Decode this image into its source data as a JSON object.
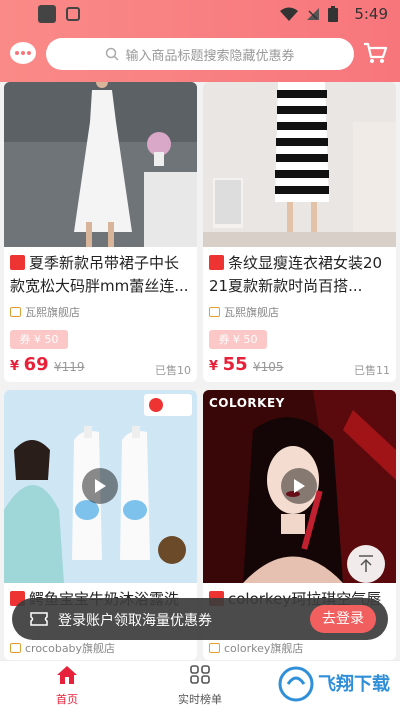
{
  "status_bar": {
    "time": "5:49"
  },
  "header": {
    "search_placeholder": "输入商品标题搜索隐藏优惠券"
  },
  "products": [
    {
      "title": "夏季新款吊带裙子中长款宽松大码胖mm蕾丝连...",
      "store": "瓦熙旗舰店",
      "coupon": "券 ¥ 50",
      "price_symbol": "¥",
      "price": "69",
      "original_price": "¥119",
      "sold": "已售10"
    },
    {
      "title": "条纹显瘦连衣裙女装2021夏款新款时尚百搭...",
      "store": "瓦熙旗舰店",
      "coupon": "券 ¥ 50",
      "price_symbol": "¥",
      "price": "55",
      "original_price": "¥105",
      "sold": "已售11"
    },
    {
      "title": "鳄鱼宝宝牛奶沐浴露洗发水二合一...",
      "store": "crocobaby旗舰店"
    },
    {
      "title": "colorkey珂拉琪空气唇釉丝绒哑光雾面...",
      "store": "colorkey旗舰店",
      "image_brand": "COLORKEY"
    }
  ],
  "login_banner": {
    "text": "登录账户领取海量优惠券",
    "button": "去登录"
  },
  "tabs": [
    {
      "label": "首页",
      "active": true
    },
    {
      "label": "实时榜单",
      "active": false
    }
  ],
  "watermark": "飞翔下载",
  "colors": {
    "accent": "#f7767c",
    "price": "#e8213a",
    "coupon_bg": "#fbc7c7"
  }
}
